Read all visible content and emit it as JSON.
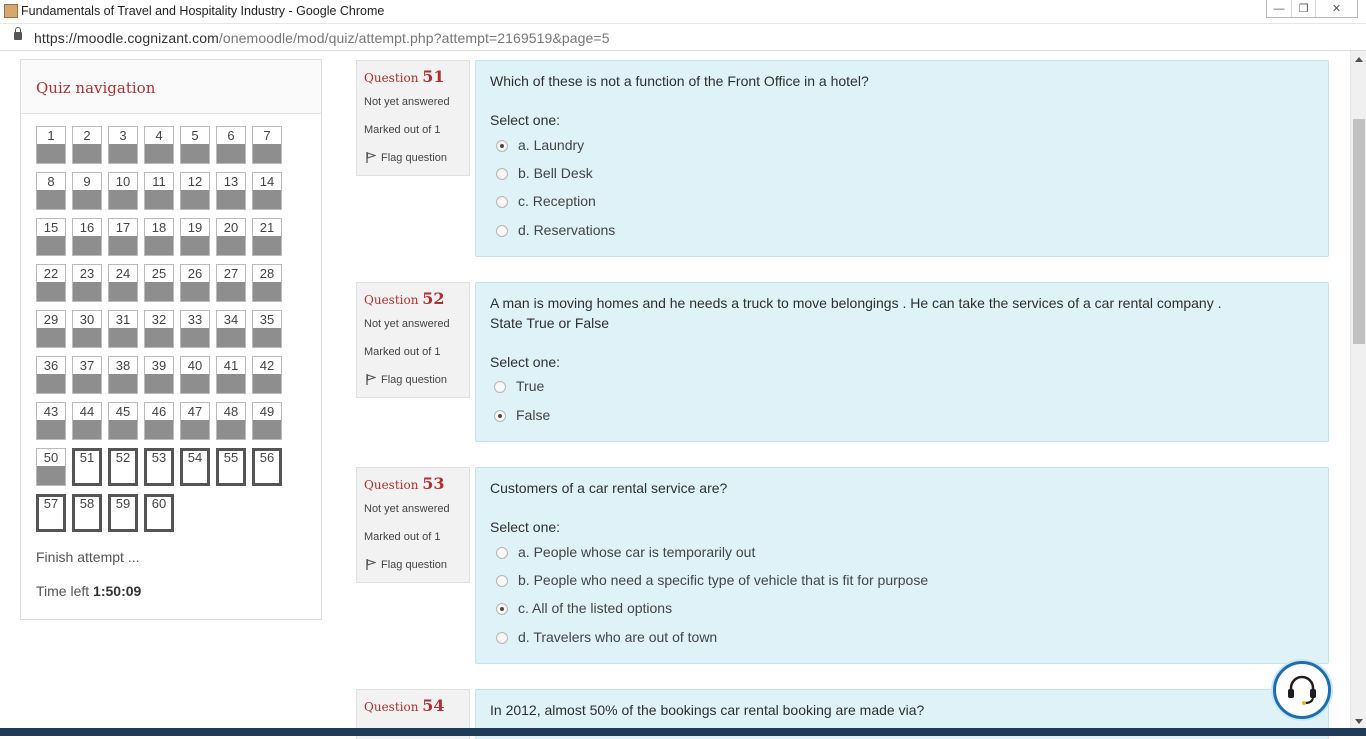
{
  "window": {
    "title": "Fundamentals of Travel and Hospitality Industry - Google Chrome",
    "controls": [
      "minimize",
      "restore",
      "close"
    ]
  },
  "address": {
    "scheme_host": "https://moodle.cognizant.com",
    "path": "/onemoodle/mod/quiz/attempt.php?attempt=2169519&page=5"
  },
  "quiz_nav": {
    "title": "Quiz navigation",
    "buttons": [
      {
        "n": "1",
        "s": "answered"
      },
      {
        "n": "2",
        "s": "answered"
      },
      {
        "n": "3",
        "s": "answered"
      },
      {
        "n": "4",
        "s": "answered"
      },
      {
        "n": "5",
        "s": "answered"
      },
      {
        "n": "6",
        "s": "answered"
      },
      {
        "n": "7",
        "s": "answered"
      },
      {
        "n": "8",
        "s": "answered"
      },
      {
        "n": "9",
        "s": "answered"
      },
      {
        "n": "10",
        "s": "answered"
      },
      {
        "n": "11",
        "s": "answered"
      },
      {
        "n": "12",
        "s": "answered"
      },
      {
        "n": "13",
        "s": "answered"
      },
      {
        "n": "14",
        "s": "answered"
      },
      {
        "n": "15",
        "s": "answered"
      },
      {
        "n": "16",
        "s": "answered"
      },
      {
        "n": "17",
        "s": "answered"
      },
      {
        "n": "18",
        "s": "answered"
      },
      {
        "n": "19",
        "s": "answered"
      },
      {
        "n": "20",
        "s": "answered"
      },
      {
        "n": "21",
        "s": "answered"
      },
      {
        "n": "22",
        "s": "answered"
      },
      {
        "n": "23",
        "s": "answered"
      },
      {
        "n": "24",
        "s": "answered"
      },
      {
        "n": "25",
        "s": "answered"
      },
      {
        "n": "26",
        "s": "answered"
      },
      {
        "n": "27",
        "s": "answered"
      },
      {
        "n": "28",
        "s": "answered"
      },
      {
        "n": "29",
        "s": "answered"
      },
      {
        "n": "30",
        "s": "answered"
      },
      {
        "n": "31",
        "s": "answered"
      },
      {
        "n": "32",
        "s": "answered"
      },
      {
        "n": "33",
        "s": "answered"
      },
      {
        "n": "34",
        "s": "answered"
      },
      {
        "n": "35",
        "s": "answered"
      },
      {
        "n": "36",
        "s": "answered"
      },
      {
        "n": "37",
        "s": "answered"
      },
      {
        "n": "38",
        "s": "answered"
      },
      {
        "n": "39",
        "s": "answered"
      },
      {
        "n": "40",
        "s": "answered"
      },
      {
        "n": "41",
        "s": "answered"
      },
      {
        "n": "42",
        "s": "answered"
      },
      {
        "n": "43",
        "s": "answered"
      },
      {
        "n": "44",
        "s": "answered"
      },
      {
        "n": "45",
        "s": "answered"
      },
      {
        "n": "46",
        "s": "answered"
      },
      {
        "n": "47",
        "s": "answered"
      },
      {
        "n": "48",
        "s": "answered"
      },
      {
        "n": "49",
        "s": "answered"
      },
      {
        "n": "50",
        "s": "answered"
      },
      {
        "n": "51",
        "s": "current"
      },
      {
        "n": "52",
        "s": "current"
      },
      {
        "n": "53",
        "s": "current"
      },
      {
        "n": "54",
        "s": "current"
      },
      {
        "n": "55",
        "s": "current"
      },
      {
        "n": "56",
        "s": "current"
      },
      {
        "n": "57",
        "s": "current"
      },
      {
        "n": "58",
        "s": "current"
      },
      {
        "n": "59",
        "s": "current"
      },
      {
        "n": "60",
        "s": "current"
      }
    ],
    "finish_label": "Finish attempt ...",
    "time_label": "Time left",
    "time_value": "1:50:09"
  },
  "questions": [
    {
      "prefix": "Question",
      "number": "51",
      "state": "Not yet answered",
      "marks": "Marked out of 1",
      "flag": "Flag question",
      "text": "Which of these is not a function of the Front Office in a hotel?",
      "select_label": "Select one:",
      "options": [
        {
          "label": "a. Laundry",
          "selected": true
        },
        {
          "label": "b. Bell Desk",
          "selected": false
        },
        {
          "label": "c. Reception",
          "selected": false
        },
        {
          "label": "d. Reservations",
          "selected": false
        }
      ]
    },
    {
      "prefix": "Question",
      "number": "52",
      "state": "Not yet answered",
      "marks": "Marked out of 1",
      "flag": "Flag question",
      "text": "A man is moving homes and he needs a truck to move belongings . He can take the services of a car rental company .",
      "text2": "State True or False",
      "select_label": "Select one:",
      "options": [
        {
          "label": "True",
          "selected": false
        },
        {
          "label": "False",
          "selected": true
        }
      ]
    },
    {
      "prefix": "Question",
      "number": "53",
      "state": "Not yet answered",
      "marks": "Marked out of 1",
      "flag": "Flag question",
      "text": "Customers of a car rental service are?",
      "select_label": "Select one:",
      "options": [
        {
          "label": "a. People whose car is temporarily out",
          "selected": false
        },
        {
          "label": "b. People who need a specific type of vehicle that is fit for purpose",
          "selected": false
        },
        {
          "label": "c. All of the listed options",
          "selected": true
        },
        {
          "label": "d. Travelers who are out of town",
          "selected": false
        }
      ]
    },
    {
      "prefix": "Question",
      "number": "54",
      "text": "In 2012, almost 50% of the bookings car rental booking are made via?"
    }
  ]
}
